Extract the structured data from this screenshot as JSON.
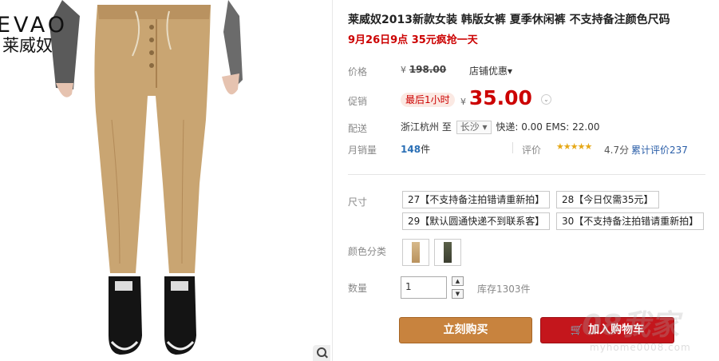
{
  "brand": {
    "logo_en": "EVAO",
    "logo_cn": "莱威奴"
  },
  "product": {
    "title": "莱威奴2013新款女装 韩版女裤 夏季休闲裤 不支持备注颜色尺码",
    "promo_line": "9月26日9点 35元疯抢一天"
  },
  "price": {
    "label": "价格",
    "currency": "¥",
    "original": "198.00",
    "shop_discount": "店铺优惠▾"
  },
  "promotion": {
    "label": "促销",
    "badge": "最后1小时",
    "currency": "¥",
    "price": "35.00",
    "more_icon": "chevron-down-icon",
    "more": "⌄"
  },
  "shipping": {
    "label": "配送",
    "from": "浙江杭州",
    "to_word": "至",
    "destination": "长沙 ▾",
    "fees": "快递: 0.00 EMS: 22.00"
  },
  "sales": {
    "label": "月销量",
    "count": "148",
    "unit": "件",
    "rating_label": "评价",
    "stars": "★★★★★",
    "score": "4.7分",
    "reviews": "累计评价237"
  },
  "sku": {
    "size_label": "尺寸",
    "sizes": [
      "27【不支持备注拍错请重新拍】",
      "28【今日仅需35元】",
      "29【默认圆通快递不到联系客】",
      "30【不支持备注拍错请重新拍】"
    ],
    "color_label": "颜色分类",
    "colors": [
      "#c9a572",
      "#474a3a"
    ]
  },
  "quantity": {
    "label": "数量",
    "value": "1",
    "up": "▲",
    "down": "▼",
    "stock": "库存1303件"
  },
  "actions": {
    "buy_now": "立刻购买",
    "cart_icon": "cart-icon",
    "cart_glyph": "🛒",
    "add_to_cart": "加入购物车"
  },
  "watermark": {
    "text": "08我家",
    "url": "myhome0008.com"
  }
}
